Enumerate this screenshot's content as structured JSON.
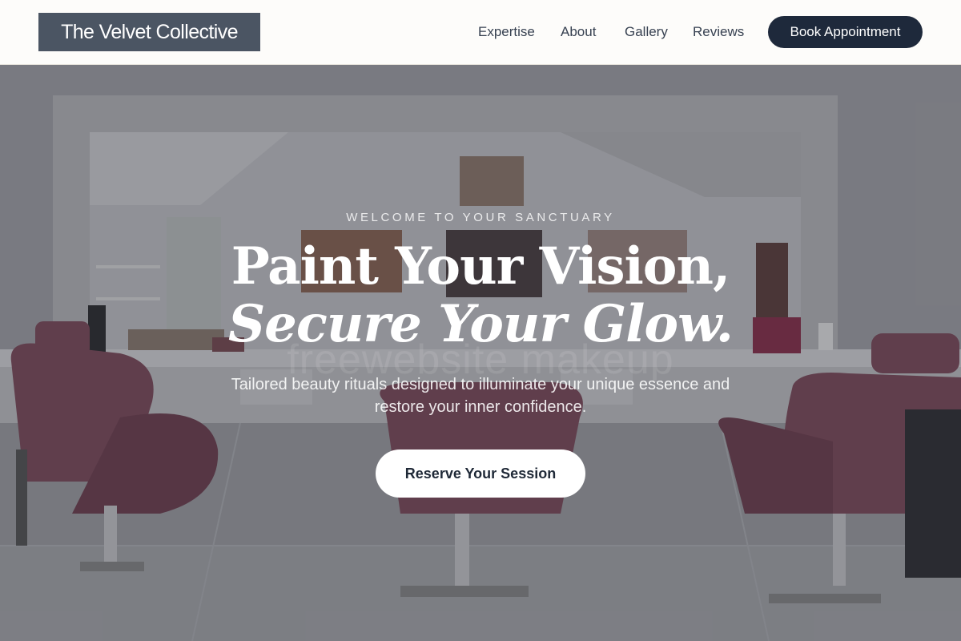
{
  "brand": {
    "name": "The Velvet Collective"
  },
  "nav": {
    "items": [
      {
        "label": "Expertise"
      },
      {
        "label": "About"
      },
      {
        "label": "Gallery"
      },
      {
        "label": "Reviews"
      }
    ],
    "cta_label": "Book Appointment"
  },
  "hero": {
    "eyebrow": "WELCOME TO YOUR SANCTUARY",
    "headline_line1": "Paint Your Vision,",
    "headline_line2": "Secure Your Glow.",
    "subtitle": "Tailored beauty rituals designed to illuminate your unique essence and restore your inner confidence.",
    "cta_label": "Reserve Your Session",
    "watermark": "freewebsite makeup"
  },
  "colors": {
    "header_bg": "#fdfcfa",
    "logo_bg": "#4b5563",
    "book_button_bg": "#1e293b",
    "cta_bg": "#ffffff",
    "chair_color": "#7e4a5a"
  }
}
